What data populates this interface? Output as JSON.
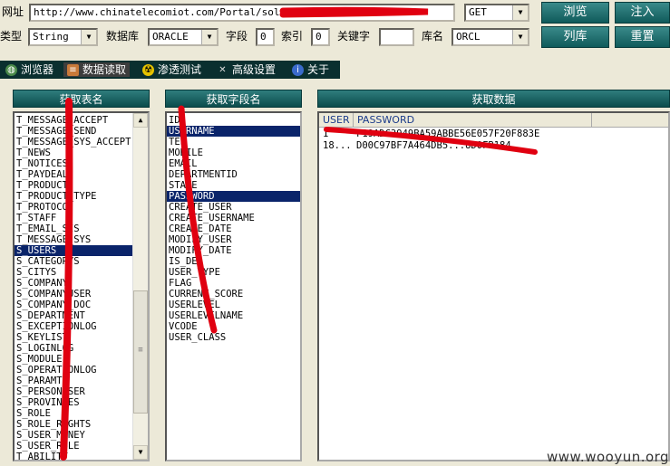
{
  "toolbar": {
    "url_label": "网址",
    "url_value": "http://www.chinatelecomiot.com/Portal/solut...5",
    "method_value": "GET",
    "browse_button": "浏览",
    "inject_button": "注入",
    "type_label": "类型",
    "type_value": "String",
    "db_label": "数据库",
    "db_value": "ORACLE",
    "field_label": "字段",
    "field_value": "0",
    "index_label": "索引",
    "index_value": "0",
    "keyword_label": "关键字",
    "keyword_value": "",
    "dbname_label": "库名",
    "dbname_value": "ORCL",
    "list_button": "列库",
    "reset_button": "重置"
  },
  "tabs": [
    {
      "label": "浏览器",
      "icon": "globe-icon",
      "active": false
    },
    {
      "label": "数据读取",
      "icon": "database-icon",
      "active": true
    },
    {
      "label": "渗透测试",
      "icon": "radiation-icon",
      "active": false
    },
    {
      "label": "高级设置",
      "icon": "tools-icon",
      "active": false
    },
    {
      "label": "关于",
      "icon": "info-icon",
      "active": false
    }
  ],
  "tables_panel": {
    "title": "获取表名",
    "items": [
      "T_MESSAGE_ACCEPT",
      "T_MESSAGE_SEND",
      "T_MESSAGE_SYS_ACCEPT",
      "T_NEWS",
      "T_NOTICES",
      "T_PAYDEAL",
      "T_PRODUCT",
      "T_PRODUCT_TYPE",
      "T_PROTOCO",
      "T_STAFF",
      "T_EMAIL_SIS",
      "T_MESSAGE_SYS",
      "S_USERS",
      "S_CATEGORYS",
      "S_CITYS",
      "S_COMPANY",
      "S_COMPANYUSER",
      "S_COMPANY_DOC",
      "S_DEPARTMENT",
      "S_EXCEPTIONLOG",
      "S_KEYLIST",
      "S_LOGINLOG",
      "S_MODULE",
      "S_OPERATIONLOG",
      "S_PARAMTE",
      "S_PERSONUSER",
      "S_PROVINCES",
      "S_ROLE",
      "S_ROLE_RIGHTS",
      "S_USER_MONEY",
      "S_USER_ROLE",
      "T_ABILITY"
    ],
    "selected_index": 12
  },
  "fields_panel": {
    "title": "获取字段名",
    "items": [
      "ID",
      "USERNAME",
      "TEL",
      "MOBILE",
      "EMAIL",
      "DEPARTMENTID",
      "STATE",
      "PASSWORD",
      "CREATE_USER",
      "CREATE_USERNAME",
      "CREATE_DATE",
      "MODIFY_USER",
      "MODIFY_DATE",
      "IS_DEL",
      "USER_TYPE",
      "FLAG",
      "CURRENT_SCORE",
      "USERLEVEL",
      "USERLEVELNAME",
      "VCODE",
      "USER_CLASS"
    ],
    "selected_indices": [
      1,
      7
    ]
  },
  "data_panel": {
    "title": "获取数据",
    "columns": [
      "USER",
      "PASSWORD"
    ],
    "rows": [
      [
        "1",
        "F19ADC3949BA59ABBE56E057F20F883E"
      ],
      [
        "18...",
        "D00C97BF7A464DB5...8D0FB184"
      ]
    ]
  },
  "watermark": "www.wooyun.org"
}
